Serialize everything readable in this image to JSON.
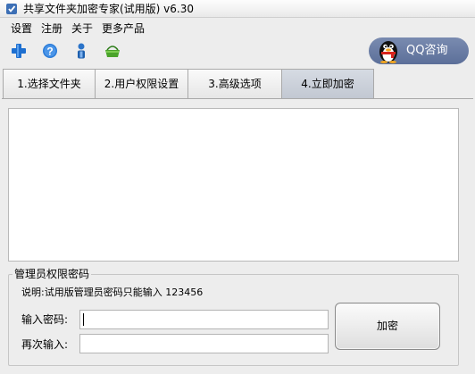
{
  "window": {
    "title": "共享文件夹加密专家(试用版) v6.30"
  },
  "menu": {
    "items": [
      "设置",
      "注册",
      "关于",
      "更多产品"
    ]
  },
  "toolbar": {
    "icons": [
      "plus-icon",
      "help-icon",
      "user-icon",
      "basket-icon"
    ]
  },
  "qq": {
    "label": "QQ咨询"
  },
  "tabs": [
    {
      "label": "1.选择文件夹",
      "active": false
    },
    {
      "label": "2.用户权限设置",
      "active": false
    },
    {
      "label": "3.高级选项",
      "active": false
    },
    {
      "label": "4.立即加密",
      "active": true
    }
  ],
  "password_group": {
    "legend": "管理员权限密码",
    "note": "说明:试用版管理员密码只能输入 123456",
    "password_label": "输入密码:",
    "password_value": "",
    "confirm_label": "再次输入:",
    "confirm_value": "",
    "encrypt_button": "加密"
  },
  "colors": {
    "window_bg": "#ededed",
    "qq_button": "#6b7ca3",
    "active_tab": "#c8cdd6",
    "plus_icon": "#1e6fd0",
    "help_icon": "#2a7bd8",
    "basket_icon": "#4aa32a"
  }
}
